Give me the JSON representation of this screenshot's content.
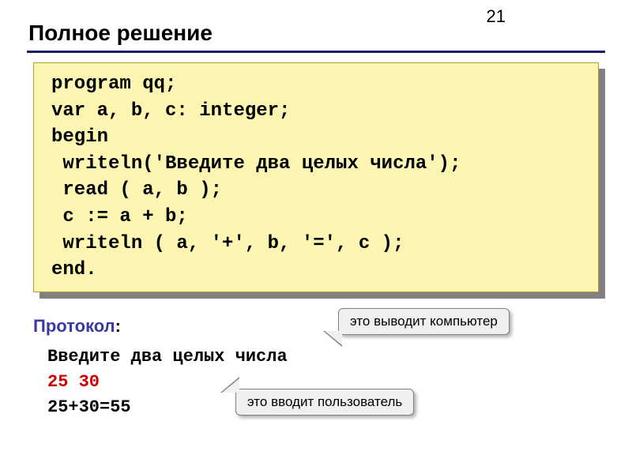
{
  "page_number": "21",
  "title": "Полное решение",
  "code": "program qq;\nvar a, b, c: integer;\nbegin\n writeln('Введите два целых числа');\n read ( a, b );\n c := a + b;\n writeln ( a, '+', b, '=', c );\nend.",
  "protocol": {
    "label": "Протокол",
    "colon": ":",
    "line1": "Введите два целых числа",
    "line2": "25  30",
    "line3": "25+30=55"
  },
  "callouts": {
    "computer_output": "это выводит компьютер",
    "user_input": "это вводит пользователь"
  }
}
